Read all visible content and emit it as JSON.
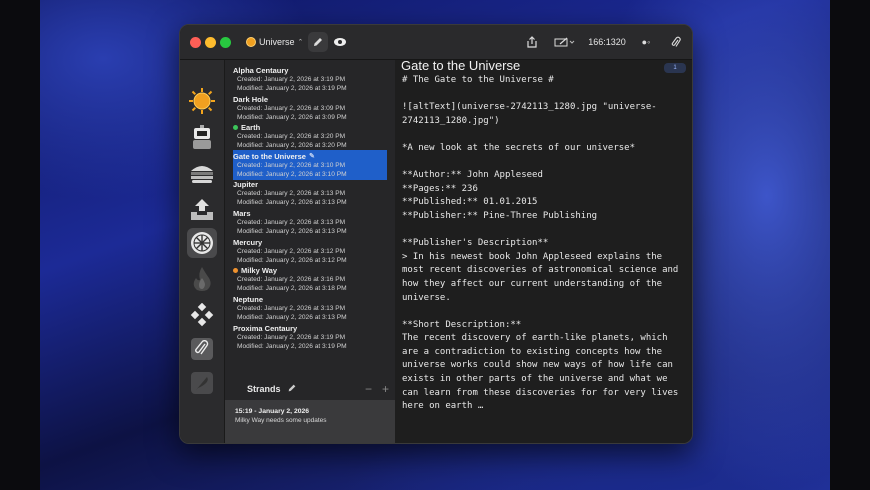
{
  "toolbar": {
    "project": "Universe",
    "counter": "166:1320",
    "toggle": "●◦"
  },
  "sidebar": {
    "items": [
      {
        "icon": "sun-icon"
      },
      {
        "icon": "robot-icon"
      },
      {
        "icon": "burger-icon"
      },
      {
        "icon": "upload-tray-icon"
      },
      {
        "icon": "compass-icon"
      },
      {
        "icon": "flame-icon"
      },
      {
        "icon": "diamonds-icon"
      },
      {
        "icon": "paperclip-icon"
      },
      {
        "icon": "feather-icon"
      }
    ]
  },
  "notes": [
    {
      "title": "Alpha Centaury",
      "created": "Created: January 2, 2026 at 3:19 PM",
      "modified": "Modified: January 2, 2026 at 3:19 PM"
    },
    {
      "title": "Dark Hole",
      "created": "Created: January 2, 2026 at 3:09 PM",
      "modified": "Modified: January 2, 2026 at 3:09 PM"
    },
    {
      "title": "Earth",
      "created": "Created: January 2, 2026 at 3:20 PM",
      "modified": "Modified: January 2, 2026 at 3:20 PM",
      "dot": "#3cc45a"
    },
    {
      "title": "Gate to the Universe",
      "created": "Created: January 2, 2026 at 3:10 PM",
      "modified": "Modified: January 2, 2026 at 3:10 PM",
      "selected": true
    },
    {
      "title": "Jupiter",
      "created": "Created: January 2, 2026 at 3:13 PM",
      "modified": "Modified: January 2, 2026 at 3:13 PM"
    },
    {
      "title": "Mars",
      "created": "Created: January 2, 2026 at 3:13 PM",
      "modified": "Modified: January 2, 2026 at 3:13 PM"
    },
    {
      "title": "Mercury",
      "created": "Created: January 2, 2026 at 3:12 PM",
      "modified": "Modified: January 2, 2026 at 3:12 PM"
    },
    {
      "title": "Milky Way",
      "created": "Created: January 2, 2026 at 3:16 PM",
      "modified": "Modified: January 2, 2026 at 3:18 PM",
      "dot": "#f0922e"
    },
    {
      "title": "Neptune",
      "created": "Created: January 2, 2026 at 3:13 PM",
      "modified": "Modified: January 2, 2026 at 3:13 PM"
    },
    {
      "title": "Proxima Centaury",
      "created": "Created: January 2, 2026 at 3:19 PM",
      "modified": "Modified: January 2, 2026 at 3:19 PM"
    }
  ],
  "strands": {
    "label": "Strands",
    "minus": "−",
    "plus": "+",
    "entry_time": "15:19 - January 2, 2026",
    "entry_text": "Milky Way needs some updates"
  },
  "editor": {
    "title": "Gate to the Universe",
    "page": "1",
    "content": "# The Gate to the Universe #\n\n![altText](universe-2742113_1280.jpg \"universe-2742113_1280.jpg\")\n\n*A new look at the secrets of our universe*\n\n**Author:** John Appleseed\n**Pages:** 236\n**Published:** 01.01.2015\n**Publisher:** Pine-Three Publishing\n\n**Publisher's Description**\n> In his newest book John Appleseed explains the most recent discoveries of astronomical science and how they affect our current understanding of the universe.\n\n**Short Description:**\nThe recent discovery of earth-like planets, which are a contradiction to existing concepts how the universe works could show new ways of how life can exists in other parts of the universe and what we can learn from these discoveries for for very lives here on earth …"
  },
  "colors": {
    "accent": "#1f5fc9",
    "earth_dot": "#3cc45a",
    "milkyway_dot": "#f0922e"
  }
}
